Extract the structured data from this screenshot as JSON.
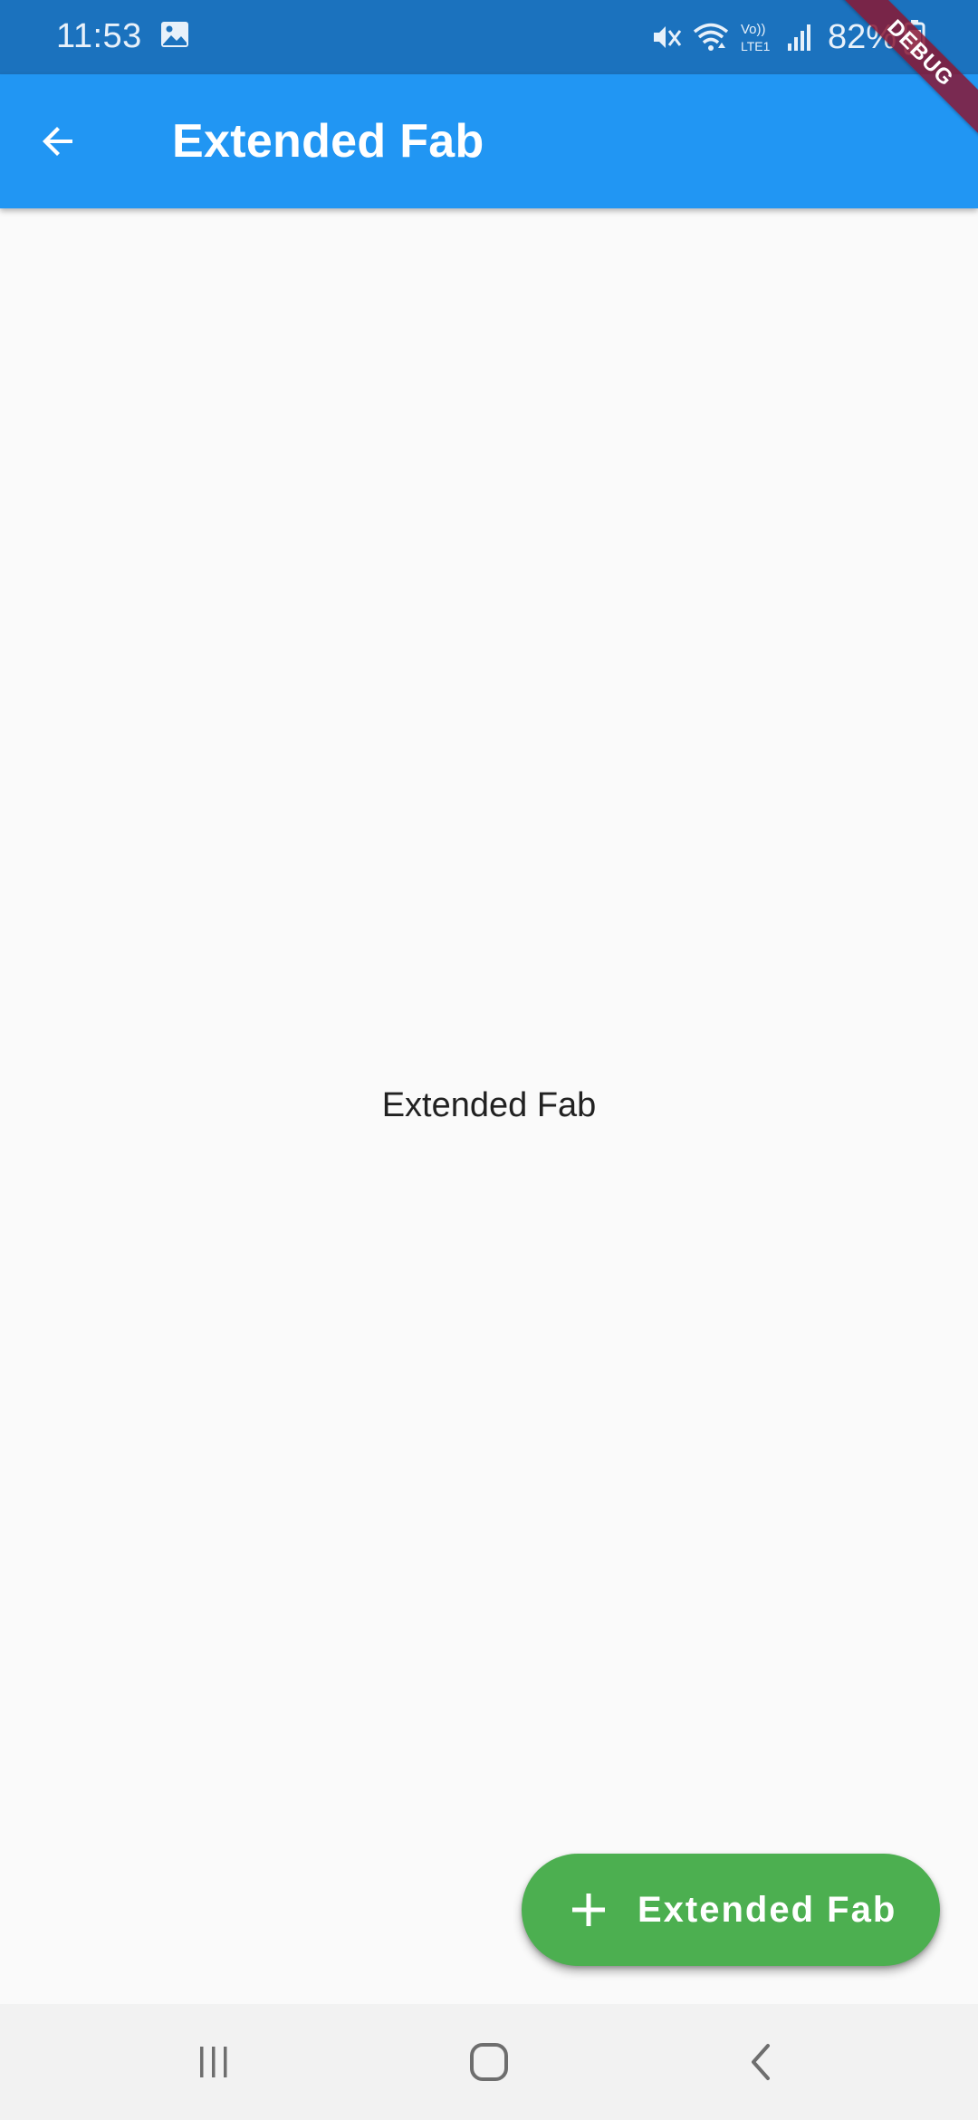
{
  "status_bar": {
    "time": "11:53",
    "battery_percent": "82%",
    "icons": [
      "gallery-icon",
      "mute-icon",
      "wifi-icon",
      "volte-lte-icon",
      "signal-icon",
      "battery-icon"
    ]
  },
  "app_bar": {
    "title": "Extended Fab",
    "back_icon": "arrow-back-icon",
    "color": "#2196F3"
  },
  "debug_banner": {
    "label": "DEBUG"
  },
  "body": {
    "center_text": "Extended Fab"
  },
  "fab": {
    "label": "Extended Fab",
    "icon": "plus-icon",
    "color": "#4CAF50"
  },
  "nav_bar": {
    "items": [
      "recents-icon",
      "home-icon",
      "back-icon"
    ]
  }
}
